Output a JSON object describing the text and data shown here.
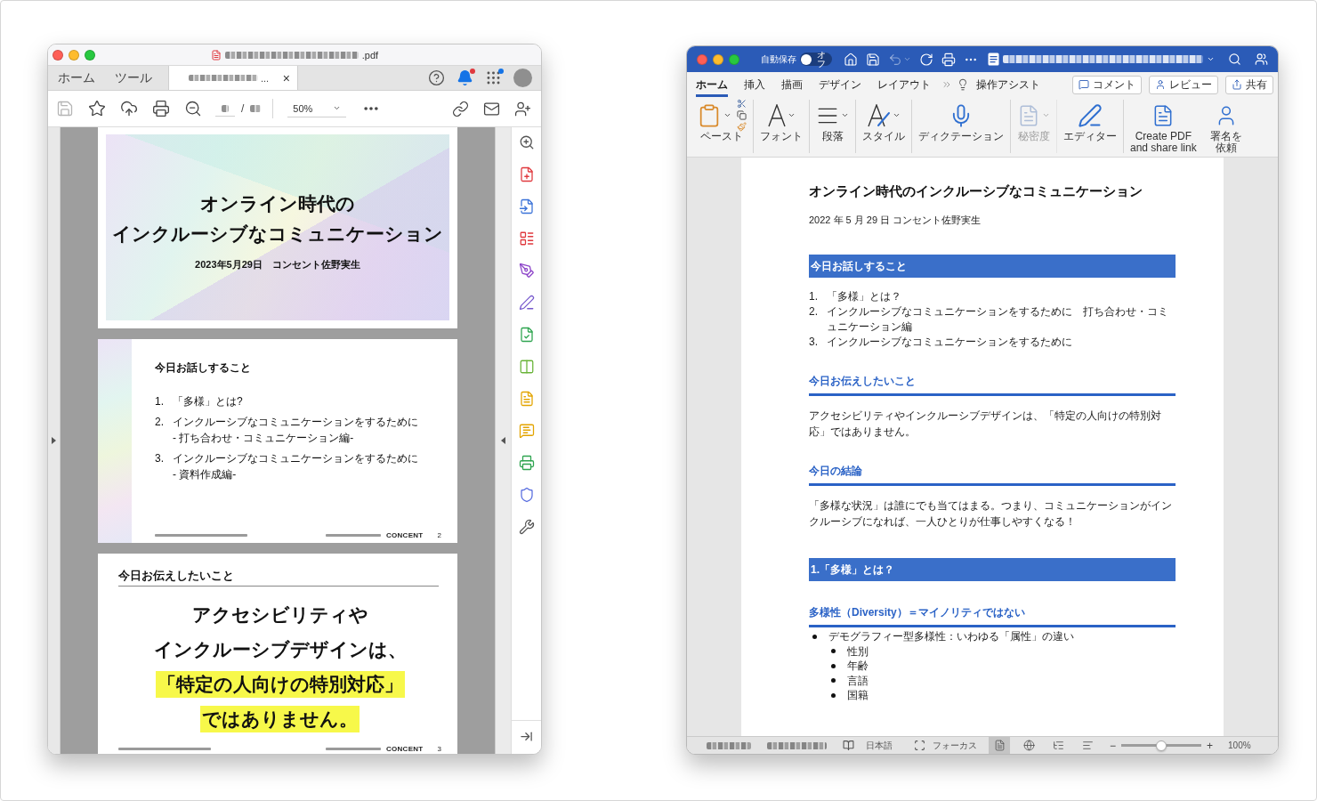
{
  "pdf_window": {
    "title": {
      "suffix": ".pdf"
    },
    "tabs": [
      {
        "label": "ホーム",
        "selected": false
      },
      {
        "label": "ツール",
        "selected": false
      }
    ],
    "document_tab": {
      "selected": true,
      "label_end": "...",
      "close": "×"
    },
    "header_icons": [
      {
        "kind": "help",
        "badge": false
      },
      {
        "kind": "bell",
        "badge": true
      },
      {
        "kind": "apps",
        "badge": true
      },
      {
        "kind": "avatar",
        "badge": false
      }
    ],
    "toolbar": [
      {
        "kind": "save",
        "disabled": true
      },
      {
        "kind": "star",
        "disabled": false
      },
      {
        "kind": "upload",
        "disabled": false
      },
      {
        "kind": "print",
        "disabled": false
      },
      {
        "kind": "zoom",
        "disabled": false
      }
    ],
    "page_nav": {
      "separator": "/"
    },
    "zoom": {
      "value": "50%"
    },
    "toolbar_right": [
      {
        "kind": "link"
      },
      {
        "kind": "mail"
      },
      {
        "kind": "add_user"
      }
    ],
    "slides": [
      {
        "kind": "title",
        "lines": [
          "オンライン時代の",
          "インクルーシブなコミュニケーション"
        ],
        "date": "2023年5月29日　コンセント佐野実生"
      },
      {
        "kind": "agenda",
        "heading": "今日お話しすること",
        "items": [
          {
            "number": "1.",
            "text": "「多様」とは?"
          },
          {
            "number": "2.",
            "text": "インクルーシブなコミュニケーションをするために",
            "sub": "- 打ち合わせ・コミュニケーション編-"
          },
          {
            "number": "3.",
            "text": "インクルーシブなコミュニケーションをするために",
            "sub": "- 資料作成編-"
          }
        ],
        "brand": "CONCENT",
        "page": "2"
      },
      {
        "kind": "message",
        "heading": "今日お伝えしたいこと",
        "lines": [
          {
            "text": "アクセシビリティや",
            "highlight": false
          },
          {
            "text": "インクルーシブデザインは、",
            "highlight": false
          },
          {
            "text": "「特定の人向けの特別対応」",
            "highlight": true
          },
          {
            "text": "ではありません。",
            "highlight": true
          }
        ],
        "brand": "CONCENT",
        "page": "3"
      }
    ]
  },
  "word_window": {
    "autosave": {
      "label": "自動保存",
      "on": false,
      "state_label": "オフ"
    },
    "quick_access": [
      {
        "kind": "home",
        "disabled": false
      },
      {
        "kind": "save",
        "disabled": false
      },
      {
        "kind": "undo",
        "disabled": true
      },
      {
        "kind": "redo",
        "disabled": false
      },
      {
        "kind": "print",
        "disabled": false
      },
      {
        "kind": "more",
        "disabled": false
      }
    ],
    "ribbon_tabs": [
      {
        "label": "ホーム",
        "selected": true
      },
      {
        "label": "挿入",
        "selected": false
      },
      {
        "label": "描画",
        "selected": false
      },
      {
        "label": "デザイン",
        "selected": false
      },
      {
        "label": "レイアウト",
        "selected": false
      }
    ],
    "tell_me": {
      "label": "操作アシスト"
    },
    "actions": [
      {
        "kind": "comment",
        "label": "コメント"
      },
      {
        "kind": "review",
        "label": "レビュー"
      },
      {
        "kind": "share",
        "label": "共有"
      }
    ],
    "ribbon_groups": [
      {
        "kind": "paste",
        "label_lines": [
          "ペースト"
        ],
        "disabled": false
      },
      {
        "kind": "font",
        "label_lines": [
          "フォント"
        ],
        "disabled": false
      },
      {
        "kind": "paragraph",
        "label_lines": [
          "段落"
        ],
        "disabled": false
      },
      {
        "kind": "styles",
        "label_lines": [
          "スタイル"
        ],
        "disabled": false
      },
      {
        "kind": "dictate",
        "label_lines": [
          "ディクテーション"
        ],
        "disabled": false
      },
      {
        "kind": "sensitivity",
        "label_lines": [
          "秘密度"
        ],
        "disabled": true
      },
      {
        "kind": "editor",
        "label_lines": [
          "エディター"
        ],
        "disabled": false
      },
      {
        "kind": "create_pdf",
        "label_lines": [
          "Create PDF",
          "and share link"
        ],
        "disabled": false
      },
      {
        "kind": "signature",
        "label_lines": [
          "署名を",
          "依頼"
        ],
        "disabled": false
      }
    ],
    "document": {
      "title": "オンライン時代のインクルーシブなコミュニケーション",
      "byline": "2022 年 5 月 29 日  コンセント佐野実生",
      "blocks": [
        {
          "kind": "band_heading",
          "text": "今日お話しすること"
        },
        {
          "kind": "numbered_list",
          "items": [
            {
              "number": "1.",
              "text": "「多様」とは？"
            },
            {
              "number": "2.",
              "text": "インクルーシブなコミュニケーションをするために　打ち合わせ・コミュニケーション編"
            },
            {
              "number": "3.",
              "text": "インクルーシブなコミュニケーションをするために"
            }
          ]
        },
        {
          "kind": "rule_heading",
          "text": "今日お伝えしたいこと"
        },
        {
          "kind": "paragraph",
          "text": "アクセシビリティやインクルーシブデザインは、「特定の人向けの特別対応」ではありません。"
        },
        {
          "kind": "rule_heading",
          "text": "今日の結論"
        },
        {
          "kind": "paragraph",
          "text": "「多様な状況」は誰にでも当てはまる。つまり、コミュニケーションがインクルーシブになれば、一人ひとりが仕事しやすくなる！"
        },
        {
          "kind": "band_heading",
          "text": "1.「多様」とは？"
        },
        {
          "kind": "rule_heading",
          "text": "多様性（Diversity）＝マイノリティではない"
        },
        {
          "kind": "bullet_list",
          "items": [
            {
              "text": "デモグラフィー型多様性：いわゆる「属性」の違い",
              "children": [
                {
                  "text": "性別"
                },
                {
                  "text": "年齢"
                },
                {
                  "text": "言語"
                },
                {
                  "text": "国籍"
                }
              ]
            }
          ]
        }
      ]
    },
    "status_bar": {
      "language": "日本語",
      "focus": "フォーカス",
      "views": [
        {
          "kind": "print",
          "selected": true
        },
        {
          "kind": "web",
          "selected": false
        },
        {
          "kind": "outline",
          "selected": false
        },
        {
          "kind": "draft",
          "selected": false
        }
      ],
      "zoom": {
        "minus": "−",
        "plus": "+",
        "level": 0.5,
        "reading": "100%"
      }
    }
  }
}
